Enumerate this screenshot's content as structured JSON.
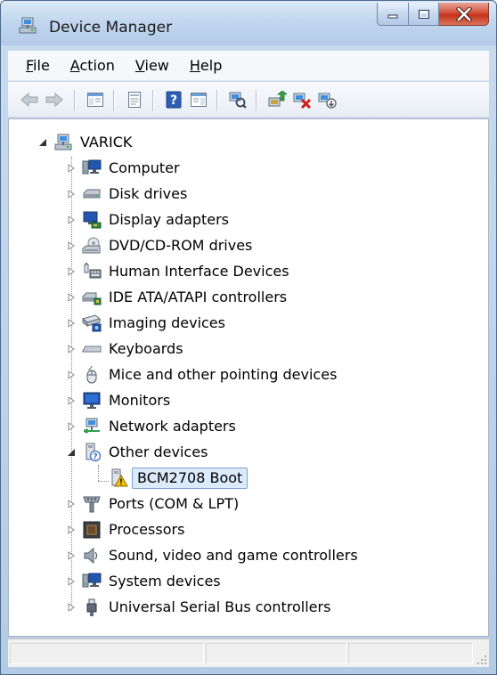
{
  "window": {
    "title": "Device Manager"
  },
  "menu": {
    "items": [
      {
        "label": "File",
        "access_key": "F"
      },
      {
        "label": "Action",
        "access_key": "A"
      },
      {
        "label": "View",
        "access_key": "V"
      },
      {
        "label": "Help",
        "access_key": "H"
      }
    ]
  },
  "toolbar": {
    "buttons": [
      {
        "name": "back-icon",
        "enabled": false
      },
      {
        "name": "forward-icon",
        "enabled": false
      },
      {
        "name": "show-hide-console-tree-icon",
        "enabled": true
      },
      {
        "name": "properties-icon",
        "enabled": true
      },
      {
        "name": "help-icon",
        "enabled": true
      },
      {
        "name": "show-hide-action-pane-icon",
        "enabled": true
      },
      {
        "name": "scan-hardware-icon",
        "enabled": true
      },
      {
        "name": "update-driver-icon",
        "enabled": true
      },
      {
        "name": "uninstall-icon",
        "enabled": true
      },
      {
        "name": "disable-device-icon",
        "enabled": true
      }
    ]
  },
  "tree": {
    "root": {
      "label": "VARICK",
      "icon": "computer-network-icon",
      "expanded": true
    },
    "categories": [
      {
        "label": "Computer",
        "icon": "computer-icon",
        "expanded": false
      },
      {
        "label": "Disk drives",
        "icon": "disk-drive-icon",
        "expanded": false
      },
      {
        "label": "Display adapters",
        "icon": "display-adapter-icon",
        "expanded": false
      },
      {
        "label": "DVD/CD-ROM drives",
        "icon": "dvd-drive-icon",
        "expanded": false
      },
      {
        "label": "Human Interface Devices",
        "icon": "hid-icon",
        "expanded": false
      },
      {
        "label": "IDE ATA/ATAPI controllers",
        "icon": "ide-controller-icon",
        "expanded": false
      },
      {
        "label": "Imaging devices",
        "icon": "imaging-device-icon",
        "expanded": false
      },
      {
        "label": "Keyboards",
        "icon": "keyboard-icon",
        "expanded": false
      },
      {
        "label": "Mice and other pointing devices",
        "icon": "mouse-icon",
        "expanded": false
      },
      {
        "label": "Monitors",
        "icon": "monitor-icon",
        "expanded": false
      },
      {
        "label": "Network adapters",
        "icon": "network-adapter-icon",
        "expanded": false
      },
      {
        "label": "Other devices",
        "icon": "unknown-device-icon",
        "expanded": true,
        "children": [
          {
            "label": "BCM2708 Boot",
            "icon": "warning-device-icon",
            "selected": true
          }
        ]
      },
      {
        "label": "Ports (COM & LPT)",
        "icon": "port-icon",
        "expanded": false
      },
      {
        "label": "Processors",
        "icon": "processor-icon",
        "expanded": false
      },
      {
        "label": "Sound, video and game controllers",
        "icon": "sound-icon",
        "expanded": false
      },
      {
        "label": "System devices",
        "icon": "system-device-icon",
        "expanded": false
      },
      {
        "label": "Universal Serial Bus controllers",
        "icon": "usb-icon",
        "expanded": false
      }
    ]
  },
  "statusbar": {
    "text": ""
  }
}
